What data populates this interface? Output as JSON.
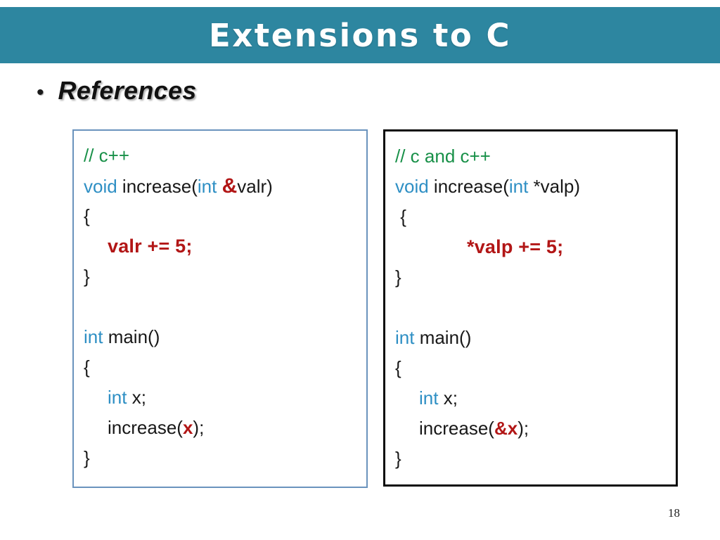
{
  "slide": {
    "title": "Extensions to C",
    "banner_color": "#2d86a0",
    "page_number": "18"
  },
  "heading": {
    "bullet": "•",
    "text": "References"
  },
  "colors": {
    "comment_green": "#189048",
    "keyword_blue": "#2e8fc4",
    "highlight_red": "#b21616",
    "left_box_border": "#6a93bd",
    "right_box_border": "#0a0a0a"
  },
  "code_left": {
    "border_color": "#6a93bd",
    "lines": [
      {
        "indent": 0,
        "tokens": [
          {
            "t": "// c++",
            "c": "comment"
          }
        ]
      },
      {
        "indent": 0,
        "tokens": [
          {
            "t": "void",
            "c": "kw"
          },
          {
            "t": " increase(",
            "c": "plain"
          },
          {
            "t": "int",
            "c": "kw"
          },
          {
            "t": " ",
            "c": "plain"
          },
          {
            "t": "&",
            "c": "hl-big"
          },
          {
            "t": "valr)",
            "c": "plain"
          }
        ]
      },
      {
        "indent": 0,
        "tokens": [
          {
            "t": "{",
            "c": "plain"
          }
        ]
      },
      {
        "indent": 1,
        "tokens": [
          {
            "t": "valr += 5;",
            "c": "stmt"
          }
        ]
      },
      {
        "indent": 0,
        "tokens": [
          {
            "t": "}",
            "c": "plain"
          }
        ]
      },
      {
        "indent": 0,
        "tokens": []
      },
      {
        "indent": 0,
        "tokens": [
          {
            "t": "int",
            "c": "kw"
          },
          {
            "t": " main()",
            "c": "plain"
          }
        ]
      },
      {
        "indent": 0,
        "tokens": [
          {
            "t": "{",
            "c": "plain"
          }
        ]
      },
      {
        "indent": 1,
        "tokens": [
          {
            "t": "int",
            "c": "kw"
          },
          {
            "t": " x;",
            "c": "plain"
          }
        ]
      },
      {
        "indent": 1,
        "tokens": [
          {
            "t": "increase(",
            "c": "plain"
          },
          {
            "t": "x",
            "c": "hl"
          },
          {
            "t": ");",
            "c": "plain"
          }
        ]
      },
      {
        "indent": 0,
        "tokens": [
          {
            "t": "}",
            "c": "plain"
          }
        ]
      }
    ]
  },
  "code_right": {
    "border_color": "#0a0a0a",
    "lines": [
      {
        "indent": 0,
        "tokens": [
          {
            "t": "// c and c++",
            "c": "comment"
          }
        ]
      },
      {
        "indent": 0,
        "tokens": [
          {
            "t": "void",
            "c": "kw"
          },
          {
            "t": " increase(",
            "c": "plain"
          },
          {
            "t": "int",
            "c": "kw"
          },
          {
            "t": " *valp)",
            "c": "plain"
          }
        ]
      },
      {
        "indent": 0,
        "tokens": [
          {
            "t": " {",
            "c": "plain"
          }
        ]
      },
      {
        "indent": 3,
        "tokens": [
          {
            "t": "*valp += 5;",
            "c": "stmt"
          }
        ]
      },
      {
        "indent": 0,
        "tokens": [
          {
            "t": "}",
            "c": "plain"
          }
        ]
      },
      {
        "indent": 0,
        "tokens": []
      },
      {
        "indent": 0,
        "tokens": [
          {
            "t": "int",
            "c": "kw"
          },
          {
            "t": " main()",
            "c": "plain"
          }
        ]
      },
      {
        "indent": 0,
        "tokens": [
          {
            "t": "{",
            "c": "plain"
          }
        ]
      },
      {
        "indent": 1,
        "tokens": [
          {
            "t": "int",
            "c": "kw"
          },
          {
            "t": " x;",
            "c": "plain"
          }
        ]
      },
      {
        "indent": 1,
        "tokens": [
          {
            "t": "increase(",
            "c": "plain"
          },
          {
            "t": "&x",
            "c": "hl"
          },
          {
            "t": ");",
            "c": "plain"
          }
        ]
      },
      {
        "indent": 0,
        "tokens": [
          {
            "t": "}",
            "c": "plain"
          }
        ]
      }
    ]
  }
}
